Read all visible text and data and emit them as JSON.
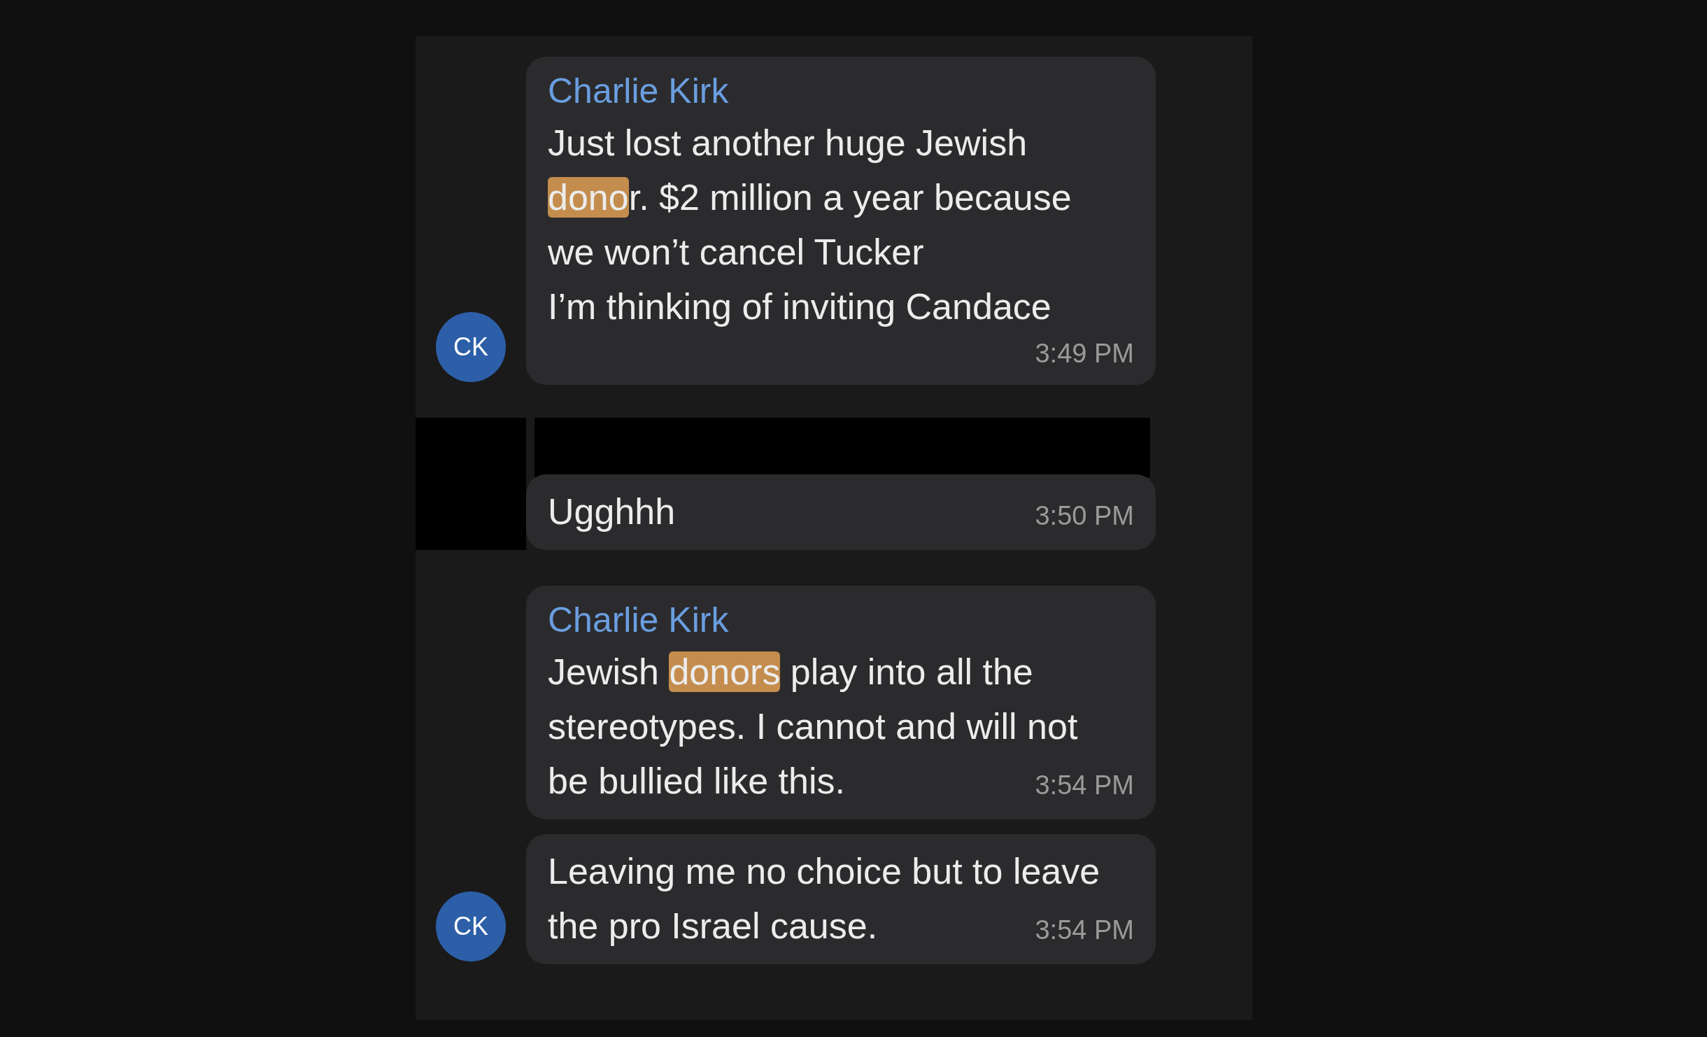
{
  "messages": [
    {
      "sender": "Charlie Kirk",
      "avatar": "CK",
      "redacted": false,
      "lines": [
        [
          {
            "text": "Just lost another huge Jewish",
            "highlighted": false
          }
        ],
        [
          {
            "text": "dono",
            "highlighted": true
          },
          {
            "text": "r. $2 million a year because",
            "highlighted": false
          }
        ],
        [
          {
            "text": "we won’t cancel Tucker",
            "highlighted": false
          }
        ],
        [
          {
            "text": "I’m thinking of inviting Candace",
            "highlighted": false
          }
        ]
      ],
      "time": "3:49 PM",
      "time_inline": false
    },
    {
      "redacted": true,
      "lines": [
        [
          {
            "text": "Ugghhh",
            "highlighted": false
          }
        ]
      ],
      "time": "3:50 PM",
      "time_inline": true
    },
    {
      "sender": "Charlie Kirk",
      "lines": [
        [
          {
            "text": "Jewish ",
            "highlighted": false
          },
          {
            "text": "donors",
            "highlighted": true
          },
          {
            "text": " play into all the",
            "highlighted": false
          }
        ],
        [
          {
            "text": "stereotypes. I cannot and will not",
            "highlighted": false
          }
        ],
        [
          {
            "text": "be bullied like this.",
            "highlighted": false
          }
        ]
      ],
      "time": "3:54 PM",
      "time_inline": true
    },
    {
      "avatar": "CK",
      "lines": [
        [
          {
            "text": "Leaving me no choice but to leave",
            "highlighted": false
          }
        ],
        [
          {
            "text": "the pro Israel cause.",
            "highlighted": false
          }
        ]
      ],
      "time": "3:54 PM",
      "time_inline": true
    }
  ]
}
